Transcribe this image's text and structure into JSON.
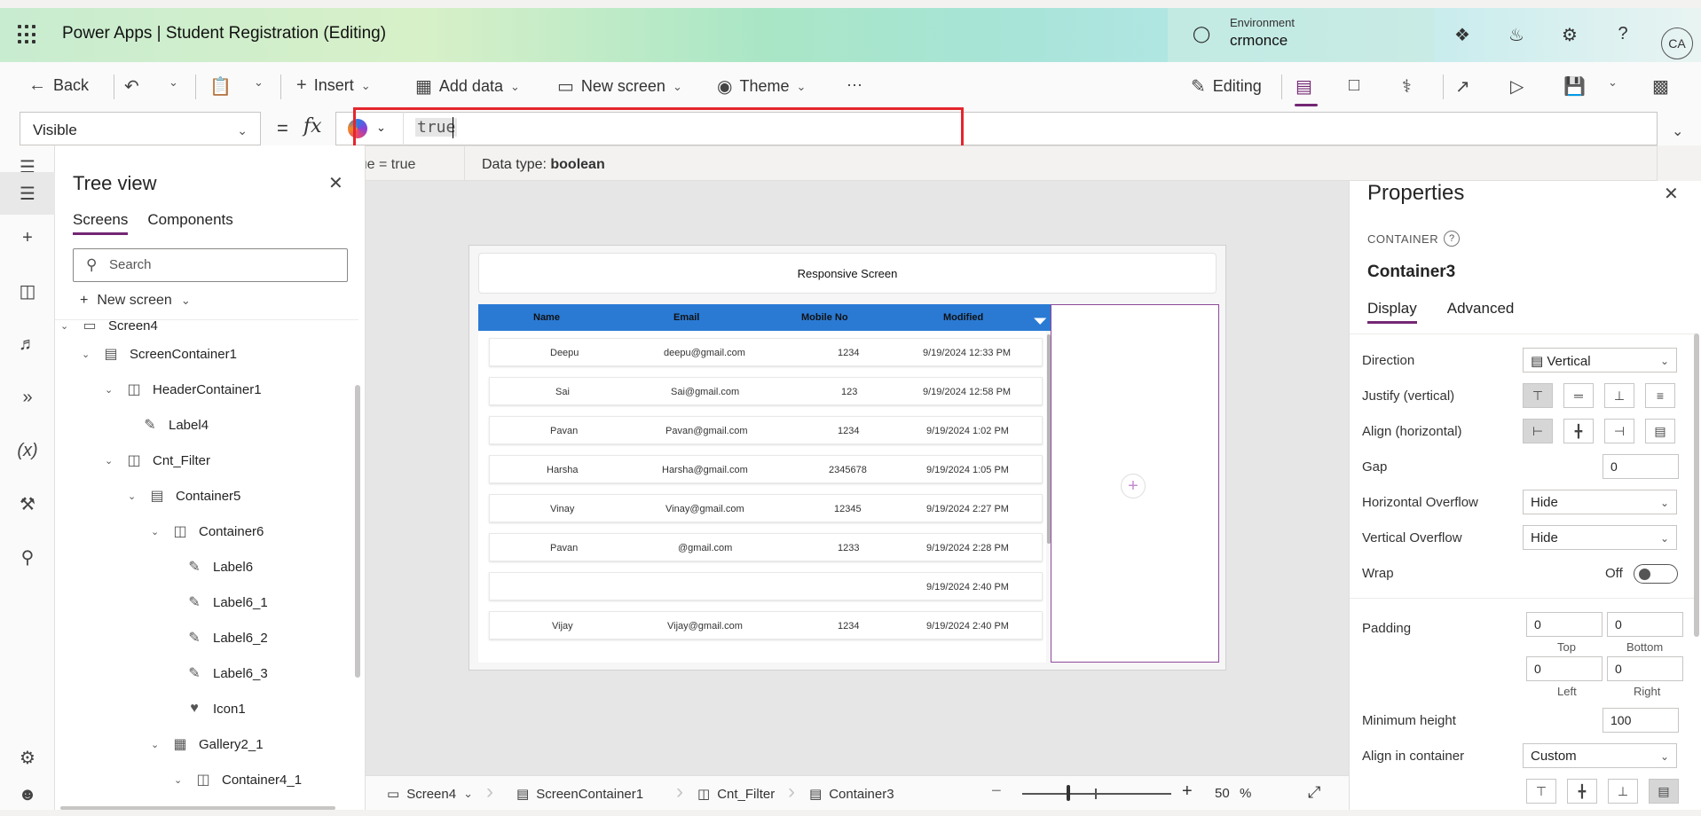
{
  "header": {
    "app_title": "Power Apps  |  Student Registration (Editing)",
    "env_label": "Environment",
    "env_name": "crmonce",
    "avatar": "CA",
    "icons": [
      "copilot-icon",
      "bell-icon",
      "gear-icon",
      "help-icon"
    ]
  },
  "toolbar": {
    "back": "Back",
    "insert": "Insert",
    "add_data": "Add data",
    "new_screen": "New screen",
    "theme": "Theme",
    "more": "···",
    "editing": "Editing"
  },
  "formula": {
    "property": "Visible",
    "equals": "=",
    "fx": "fx",
    "value": "true",
    "hint_left": "true  =  true",
    "hint_type_label": "Data type: ",
    "hint_type": "boolean"
  },
  "tree": {
    "title": "Tree view",
    "tabs": [
      "Screens",
      "Components"
    ],
    "search_placeholder": "Search",
    "new_screen": "New screen",
    "items": [
      {
        "label": "Screen4"
      },
      {
        "label": "ScreenContainer1"
      },
      {
        "label": "HeaderContainer1"
      },
      {
        "label": "Label4"
      },
      {
        "label": "Cnt_Filter"
      },
      {
        "label": "Container5"
      },
      {
        "label": "Container6"
      },
      {
        "label": "Label6"
      },
      {
        "label": "Label6_1"
      },
      {
        "label": "Label6_2"
      },
      {
        "label": "Label6_3"
      },
      {
        "label": "Icon1"
      },
      {
        "label": "Gallery2_1"
      },
      {
        "label": "Container4_1"
      }
    ]
  },
  "canvas": {
    "header_title": "Responsive Screen",
    "columns": [
      "Name",
      "Email",
      "Mobile No",
      "Modified"
    ],
    "rows": [
      {
        "name": "Deepu",
        "email": "deepu@gmail.com",
        "mobile": "1234",
        "modified": "9/19/2024 12:33 PM"
      },
      {
        "name": "Sai",
        "email": "Sai@gmail.com",
        "mobile": "123",
        "modified": "9/19/2024 12:58 PM"
      },
      {
        "name": "Pavan",
        "email": "Pavan@gmail.com",
        "mobile": "1234",
        "modified": "9/19/2024 1:02 PM"
      },
      {
        "name": "Harsha",
        "email": "Harsha@gmail.com",
        "mobile": "2345678",
        "modified": "9/19/2024 1:05 PM"
      },
      {
        "name": "Vinay",
        "email": "Vinay@gmail.com",
        "mobile": "12345",
        "modified": "9/19/2024 2:27 PM"
      },
      {
        "name": "Pavan",
        "email": "@gmail.com",
        "mobile": "1233",
        "modified": "9/19/2024 2:28 PM"
      },
      {
        "name": "",
        "email": "",
        "mobile": "",
        "modified": "9/19/2024 2:40 PM"
      },
      {
        "name": "Vijay",
        "email": "Vijay@gmail.com",
        "mobile": "1234",
        "modified": "9/19/2024 2:40 PM"
      }
    ]
  },
  "status": {
    "crumbs": [
      "Screen4",
      "ScreenContainer1",
      "Cnt_Filter",
      "Container3"
    ],
    "zoom": "50",
    "zoom_unit": "%"
  },
  "properties": {
    "title": "Properties",
    "type": "CONTAINER",
    "name": "Container3",
    "tabs": [
      "Display",
      "Advanced"
    ],
    "direction_label": "Direction",
    "direction_value": "Vertical",
    "justify_label": "Justify (vertical)",
    "align_label": "Align (horizontal)",
    "gap_label": "Gap",
    "gap_value": "0",
    "h_overflow_label": "Horizontal Overflow",
    "h_overflow_value": "Hide",
    "v_overflow_label": "Vertical Overflow",
    "v_overflow_value": "Hide",
    "wrap_label": "Wrap",
    "wrap_value": "Off",
    "padding_label": "Padding",
    "padding_top": "0",
    "padding_bottom": "0",
    "padding_left": "0",
    "padding_right": "0",
    "top_label": "Top",
    "bottom_label": "Bottom",
    "left_label": "Left",
    "right_label": "Right",
    "min_height_label": "Minimum height",
    "min_height_value": "100",
    "align_container_label": "Align in container",
    "align_container_value": "Custom"
  }
}
